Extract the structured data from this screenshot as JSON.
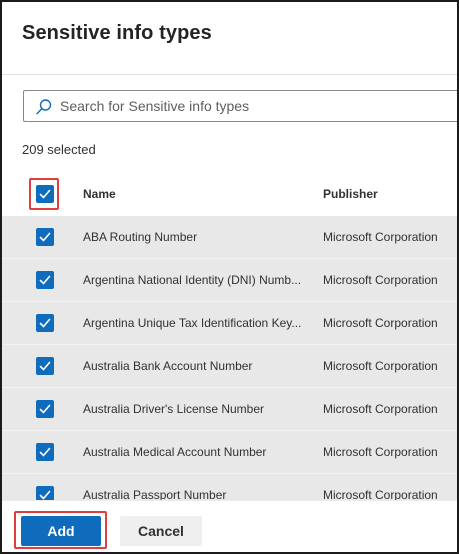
{
  "panel": {
    "title": "Sensitive info types"
  },
  "search": {
    "placeholder": "Search for Sensitive info types",
    "value": "",
    "icon": "search-icon"
  },
  "selection": {
    "count_label": "209 selected",
    "select_all_checked": true
  },
  "table": {
    "columns": [
      "Name",
      "Publisher"
    ],
    "rows": [
      {
        "name": "ABA Routing Number",
        "publisher": "Microsoft Corporation",
        "checked": true
      },
      {
        "name": "Argentina National Identity (DNI) Numb...",
        "publisher": "Microsoft Corporation",
        "checked": true
      },
      {
        "name": "Argentina Unique Tax Identification Key...",
        "publisher": "Microsoft Corporation",
        "checked": true
      },
      {
        "name": "Australia Bank Account Number",
        "publisher": "Microsoft Corporation",
        "checked": true
      },
      {
        "name": "Australia Driver's License Number",
        "publisher": "Microsoft Corporation",
        "checked": true
      },
      {
        "name": "Australia Medical Account Number",
        "publisher": "Microsoft Corporation",
        "checked": true
      },
      {
        "name": "Australia Passport Number",
        "publisher": "Microsoft Corporation",
        "checked": true
      }
    ]
  },
  "footer": {
    "add_label": "Add",
    "cancel_label": "Cancel"
  },
  "colors": {
    "accent": "#0f6cbd",
    "highlight": "#e03e3e",
    "row_selected_bg": "#e8e8e8"
  }
}
